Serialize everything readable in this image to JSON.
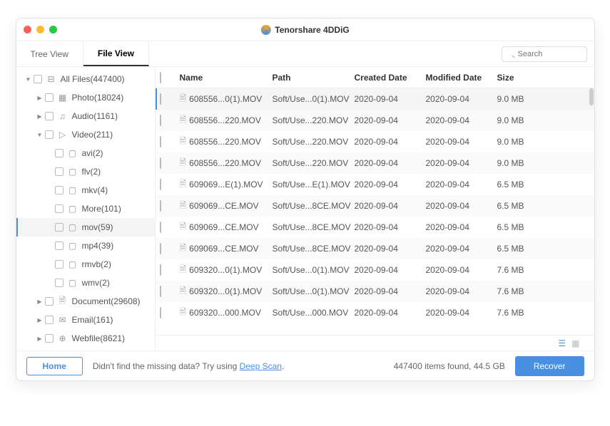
{
  "window": {
    "title": "Tenorshare 4DDiG"
  },
  "tabs": {
    "tree": "Tree View",
    "file": "File View"
  },
  "search": {
    "placeholder": "Search"
  },
  "tree": {
    "root": "All Files(447400)",
    "photo": "Photo(18024)",
    "audio": "Audio(1161)",
    "video": "Video(211)",
    "avi": "avi(2)",
    "flv": "flv(2)",
    "mkv": "mkv(4)",
    "more": "More(101)",
    "mov": "mov(59)",
    "mp4": "mp4(39)",
    "rmvb": "rmvb(2)",
    "wmv": "wmv(2)",
    "document": "Document(29608)",
    "email": "Email(161)",
    "webfile": "Webfile(8621)"
  },
  "headers": {
    "name": "Name",
    "path": "Path",
    "created": "Created Date",
    "modified": "Modified Date",
    "size": "Size"
  },
  "rows": [
    {
      "name": "608556...0(1).MOV",
      "path": "Soft/Use...0(1).MOV",
      "created": "2020-09-04",
      "modified": "2020-09-04",
      "size": "9.0 MB"
    },
    {
      "name": "608556...220.MOV",
      "path": "Soft/Use...220.MOV",
      "created": "2020-09-04",
      "modified": "2020-09-04",
      "size": "9.0 MB"
    },
    {
      "name": "608556...220.MOV",
      "path": "Soft/Use...220.MOV",
      "created": "2020-09-04",
      "modified": "2020-09-04",
      "size": "9.0 MB"
    },
    {
      "name": "608556...220.MOV",
      "path": "Soft/Use...220.MOV",
      "created": "2020-09-04",
      "modified": "2020-09-04",
      "size": "9.0 MB"
    },
    {
      "name": "609069...E(1).MOV",
      "path": "Soft/Use...E(1).MOV",
      "created": "2020-09-04",
      "modified": "2020-09-04",
      "size": "6.5 MB"
    },
    {
      "name": "609069...CE.MOV",
      "path": "Soft/Use...8CE.MOV",
      "created": "2020-09-04",
      "modified": "2020-09-04",
      "size": "6.5 MB"
    },
    {
      "name": "609069...CE.MOV",
      "path": "Soft/Use...8CE.MOV",
      "created": "2020-09-04",
      "modified": "2020-09-04",
      "size": "6.5 MB"
    },
    {
      "name": "609069...CE.MOV",
      "path": "Soft/Use...8CE.MOV",
      "created": "2020-09-04",
      "modified": "2020-09-04",
      "size": "6.5 MB"
    },
    {
      "name": "609320...0(1).MOV",
      "path": "Soft/Use...0(1).MOV",
      "created": "2020-09-04",
      "modified": "2020-09-04",
      "size": "7.6 MB"
    },
    {
      "name": "609320...0(1).MOV",
      "path": "Soft/Use...0(1).MOV",
      "created": "2020-09-04",
      "modified": "2020-09-04",
      "size": "7.6 MB"
    },
    {
      "name": "609320...000.MOV",
      "path": "Soft/Use...000.MOV",
      "created": "2020-09-04",
      "modified": "2020-09-04",
      "size": "7.6 MB"
    }
  ],
  "footer": {
    "home": "Home",
    "hint_pre": "Didn't find the missing data? Try using ",
    "hint_link": "Deep Scan",
    "status": "447400 items found, 44.5 GB",
    "recover": "Recover"
  }
}
